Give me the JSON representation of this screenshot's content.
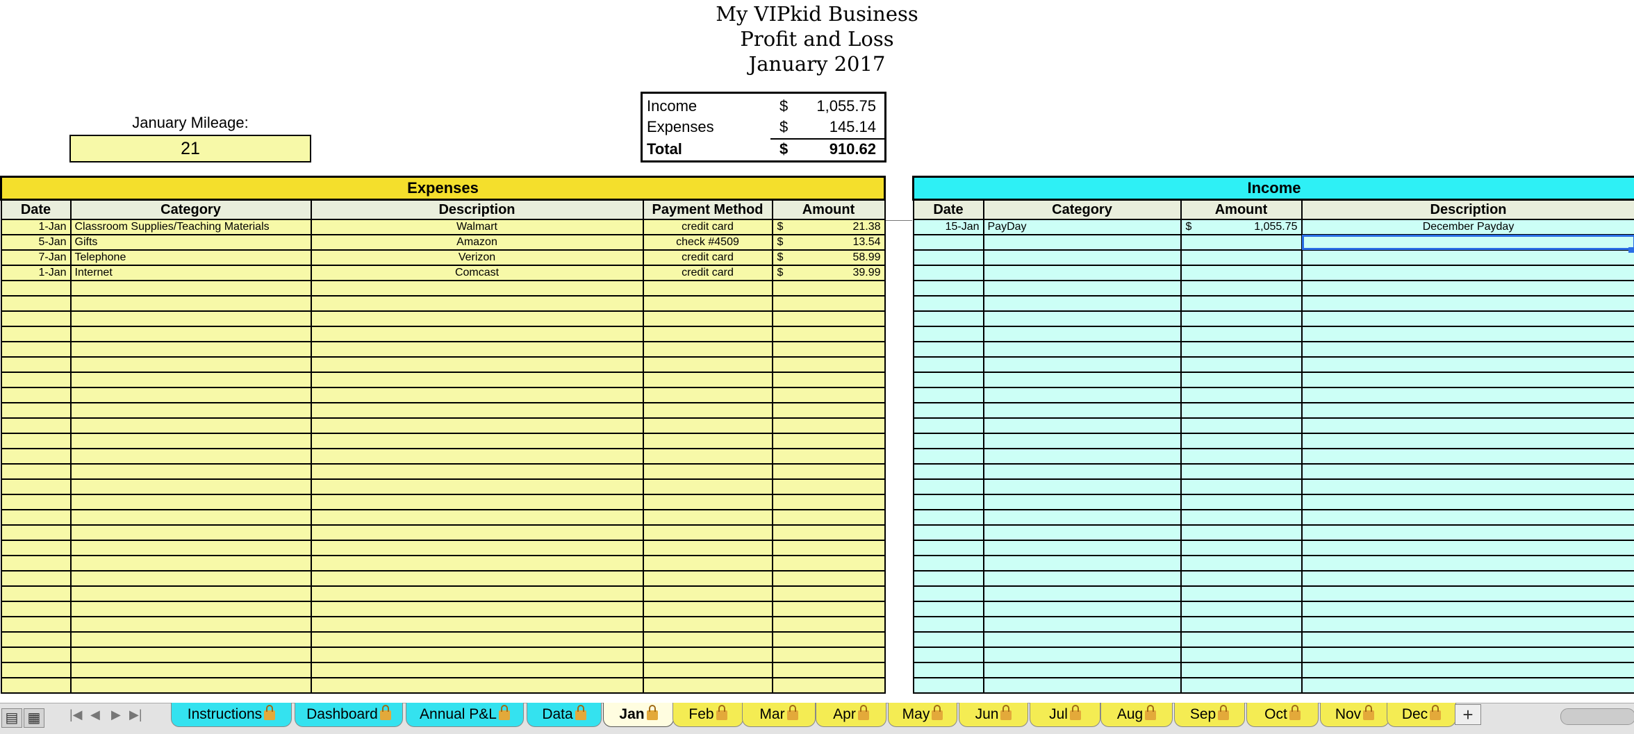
{
  "title": {
    "line1": "My VIPkid Business",
    "line2": "Profit and Loss",
    "line3": "January 2017"
  },
  "mileage": {
    "label": "January Mileage:",
    "value": "21"
  },
  "summary": {
    "rows": [
      {
        "label": "Income",
        "currency": "$",
        "amount": "1,055.75"
      },
      {
        "label": "Expenses",
        "currency": "$",
        "amount": "145.14"
      },
      {
        "label": "Total",
        "currency": "$",
        "amount": "910.62"
      }
    ]
  },
  "expenses": {
    "section_label": "Expenses",
    "columns": [
      "Date",
      "Category",
      "Description",
      "Payment Method",
      "Amount"
    ],
    "rows": [
      {
        "date": "1-Jan",
        "category": "Classroom Supplies/Teaching Materials",
        "description": "Walmart",
        "payment": "credit card",
        "currency": "$",
        "amount": "21.38"
      },
      {
        "date": "5-Jan",
        "category": "Gifts",
        "description": "Amazon",
        "payment": "check #4509",
        "currency": "$",
        "amount": "13.54"
      },
      {
        "date": "7-Jan",
        "category": "Telephone",
        "description": "Verizon",
        "payment": "credit card",
        "currency": "$",
        "amount": "58.99"
      },
      {
        "date": "1-Jan",
        "category": "Internet",
        "description": "Comcast",
        "payment": "credit card",
        "currency": "$",
        "amount": "39.99"
      }
    ],
    "empty_rows": 27
  },
  "income": {
    "section_label": "Income",
    "columns": [
      "Date",
      "Category",
      "Amount",
      "Description"
    ],
    "rows": [
      {
        "date": "15-Jan",
        "category": "PayDay",
        "currency": "$",
        "amount": "1,055.75",
        "description": "December Payday"
      }
    ],
    "empty_rows": 30
  },
  "sheet_tabs": [
    {
      "label": "Instructions",
      "style": "cyan"
    },
    {
      "label": "Dashboard",
      "style": "cyan"
    },
    {
      "label": "Annual P&L",
      "style": "cyan"
    },
    {
      "label": "Data",
      "style": "cyan"
    },
    {
      "label": "Jan",
      "style": "active"
    },
    {
      "label": "Feb",
      "style": "yellow"
    },
    {
      "label": "Mar",
      "style": "yellow"
    },
    {
      "label": "Apr",
      "style": "yellow"
    },
    {
      "label": "May",
      "style": "yellow"
    },
    {
      "label": "Jun",
      "style": "yellow"
    },
    {
      "label": "Jul",
      "style": "yellow"
    },
    {
      "label": "Aug",
      "style": "yellow"
    },
    {
      "label": "Sep",
      "style": "yellow"
    },
    {
      "label": "Oct",
      "style": "yellow"
    },
    {
      "label": "Nov",
      "style": "yellow"
    },
    {
      "label": "Dec",
      "style": "yellow"
    }
  ],
  "add_sheet_label": "+",
  "colors": {
    "expenses_header": "#f4df2c",
    "expenses_fill": "#f7f9a8",
    "income_header": "#2ef0f5",
    "income_fill": "#ccfff6",
    "selection": "#2a6ee6"
  },
  "icons": {
    "tab_lock": "lock-icon",
    "view_normal": "normal-view-icon",
    "view_page_layout": "page-layout-view-icon",
    "nav": [
      "first-sheet-icon",
      "prev-sheet-icon",
      "next-sheet-icon",
      "last-sheet-icon"
    ]
  }
}
